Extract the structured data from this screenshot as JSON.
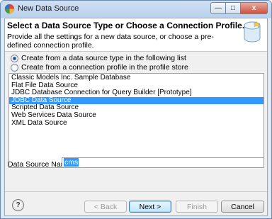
{
  "window": {
    "title": "New Data Source",
    "minimize": "—",
    "maximize": "□",
    "close": "x"
  },
  "header": {
    "title": "Select a Data Source Type or Choose a Connection Profile.",
    "description": "Provide all the settings for a new data source, or choose a pre-defined connection profile."
  },
  "options": {
    "create_from_type": "Create from a data source type in the following list",
    "create_from_profile": "Create from a connection profile in the profile store",
    "selected": "create_from_type"
  },
  "data_sources": [
    "Classic Models Inc. Sample Database",
    "Flat File Data Source",
    "JDBC Database Connection for Query Builder [Prototype]",
    "JDBC Data Source",
    "Scripted Data Source",
    "Web Services Data Source",
    "XML Data Source"
  ],
  "selected_data_source": "JDBC Data Source",
  "name_field": {
    "label": "Data Source Name:",
    "value": "cms"
  },
  "buttons": {
    "help": "?",
    "back": "< Back",
    "next": "Next >",
    "finish": "Finish",
    "cancel": "Cancel"
  },
  "colors": {
    "selection": "#3399ff"
  }
}
